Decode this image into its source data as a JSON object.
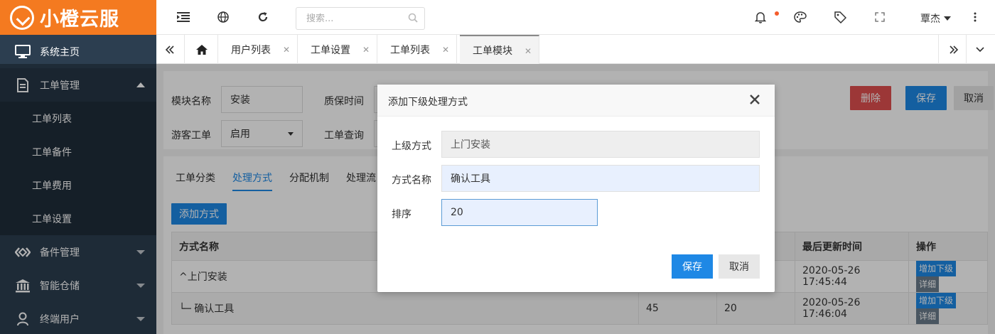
{
  "brand": {
    "name": "小橙云服"
  },
  "sidebar": {
    "items": [
      {
        "label": "系统主页",
        "icon": "monitor-icon"
      },
      {
        "label": "工单管理",
        "icon": "document-icon",
        "expanded": true,
        "children": [
          "工单列表",
          "工单备件",
          "工单费用",
          "工单设置"
        ]
      },
      {
        "label": "备件管理",
        "icon": "diamond-icon"
      },
      {
        "label": "智能仓储",
        "icon": "bank-icon"
      },
      {
        "label": "终端用户",
        "icon": "user-icon"
      }
    ]
  },
  "header": {
    "search_placeholder": "搜索...",
    "username": "覃杰"
  },
  "tabs": [
    {
      "label": "用户列表"
    },
    {
      "label": "工单设置"
    },
    {
      "label": "工单列表"
    },
    {
      "label": "工单模块",
      "active": true
    }
  ],
  "form": {
    "module_name_label": "模块名称",
    "module_name_value": "安装",
    "warranty_label": "质保时间",
    "guest_label": "游客工单",
    "guest_value": "启用",
    "query_label": "工单查询",
    "delete_label": "删除",
    "save_label": "保存",
    "cancel_label": "取消"
  },
  "subtabs": [
    "工单分类",
    "处理方式",
    "分配机制",
    "处理流"
  ],
  "add_method_label": "添加方式",
  "table": {
    "headers": [
      "方式名称",
      "",
      "",
      "最后更新时间",
      "操作"
    ],
    "rows": [
      {
        "name": "^上门安装",
        "c2": "",
        "c3": "",
        "updated": "2020-05-26 17:45:44"
      },
      {
        "name": "└─ 确认工具",
        "c2": "45",
        "c3": "20",
        "updated": "2020-05-26 17:46:04"
      }
    ],
    "action_add_child": "增加下级",
    "action_detail": "详细"
  },
  "modal": {
    "title": "添加下级处理方式",
    "parent_label": "上级方式",
    "parent_value": "上门安装",
    "name_label": "方式名称",
    "name_value": "确认工具",
    "order_label": "排序",
    "order_value": "20",
    "save_label": "保存",
    "cancel_label": "取消"
  },
  "colors": {
    "brand_orange": "#f47a20",
    "sidebar_bg": "#2c3e50",
    "primary_blue": "#1e88e5",
    "danger_red": "#e05050",
    "muted_grey": "#e7e7e7"
  }
}
